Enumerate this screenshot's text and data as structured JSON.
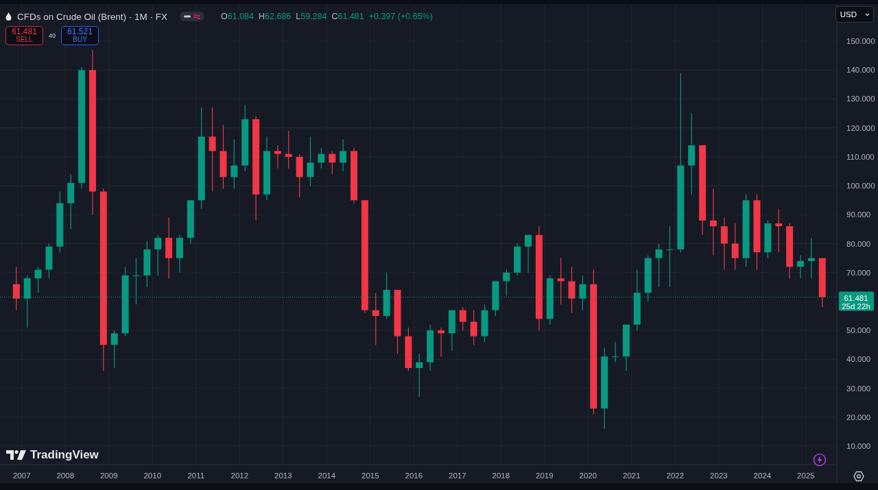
{
  "legend": {
    "symbol": "CFDs on Crude Oil (Brent) · 1M · FX",
    "visible": true,
    "ohlc": [
      {
        "letter": "O",
        "value": "61.084"
      },
      {
        "letter": "H",
        "value": "62.686"
      },
      {
        "letter": "L",
        "value": "59.284"
      },
      {
        "letter": "C",
        "value": "61.481"
      }
    ],
    "change": "+0.397 (+0.65%)"
  },
  "trade": {
    "sell": {
      "price": "61.481",
      "label": "SELL"
    },
    "spread": "40",
    "buy": {
      "price": "61.521",
      "label": "BUY"
    }
  },
  "currency": "USD",
  "price_tag": {
    "price": "61.481",
    "countdown": "25d 22h"
  },
  "brand": "TradingView",
  "chart_data": {
    "type": "candlestick",
    "grid": true,
    "x": [
      2006.875,
      2007.125,
      2007.375,
      2007.625,
      2007.875,
      2008.125,
      2008.375,
      2008.625,
      2008.875,
      2009.125,
      2009.375,
      2009.625,
      2009.875,
      2010.125,
      2010.375,
      2010.625,
      2010.875,
      2011.125,
      2011.375,
      2011.625,
      2011.875,
      2012.125,
      2012.375,
      2012.625,
      2012.875,
      2013.125,
      2013.375,
      2013.625,
      2013.875,
      2014.125,
      2014.375,
      2014.625,
      2014.875,
      2015.125,
      2015.375,
      2015.625,
      2015.875,
      2016.125,
      2016.375,
      2016.625,
      2016.875,
      2017.125,
      2017.375,
      2017.625,
      2017.875,
      2018.125,
      2018.375,
      2018.625,
      2018.875,
      2019.125,
      2019.375,
      2019.625,
      2019.875,
      2020.125,
      2020.375,
      2020.625,
      2020.875,
      2021.125,
      2021.375,
      2021.625,
      2021.875,
      2022.125,
      2022.375,
      2022.625,
      2022.875,
      2023.125,
      2023.375,
      2023.625,
      2023.875,
      2024.125,
      2024.375,
      2024.625,
      2024.875,
      2025.125,
      2025.375
    ],
    "ohlc": [
      [
        66,
        72,
        57,
        61
      ],
      [
        61,
        69,
        51,
        68
      ],
      [
        68,
        72,
        63,
        71
      ],
      [
        71,
        80,
        68,
        79
      ],
      [
        79,
        98,
        77,
        94
      ],
      [
        94,
        104,
        85,
        101
      ],
      [
        101,
        141,
        99,
        140
      ],
      [
        140,
        147,
        90,
        98
      ],
      [
        98,
        99,
        36,
        45
      ],
      [
        45,
        50,
        37,
        49
      ],
      [
        49,
        72,
        48,
        69
      ],
      [
        69,
        75,
        59,
        69
      ],
      [
        69,
        81,
        65,
        78
      ],
      [
        78,
        83,
        69,
        82
      ],
      [
        82,
        89,
        68,
        75
      ],
      [
        75,
        83,
        70,
        82
      ],
      [
        82,
        95,
        80,
        95
      ],
      [
        95,
        127,
        92,
        117
      ],
      [
        117,
        127,
        98,
        112
      ],
      [
        112,
        121,
        99,
        103
      ],
      [
        103,
        116,
        99,
        107
      ],
      [
        107,
        128,
        105,
        123
      ],
      [
        123,
        124,
        88,
        97
      ],
      [
        97,
        117,
        95,
        112
      ],
      [
        112,
        114,
        106,
        111
      ],
      [
        111,
        119,
        106,
        110
      ],
      [
        110,
        111,
        96,
        103
      ],
      [
        103,
        117,
        100,
        108
      ],
      [
        108,
        113,
        106,
        111
      ],
      [
        111,
        112,
        104,
        108
      ],
      [
        108,
        116,
        105,
        112
      ],
      [
        112,
        113,
        94,
        95
      ],
      [
        95,
        95,
        56,
        57
      ],
      [
        57,
        63,
        45,
        55
      ],
      [
        55,
        70,
        54,
        64
      ],
      [
        64,
        64,
        42,
        48
      ],
      [
        48,
        51,
        36,
        37
      ],
      [
        37,
        42,
        27,
        39
      ],
      [
        39,
        52,
        36,
        50
      ],
      [
        50,
        51,
        41,
        49
      ],
      [
        49,
        57,
        43,
        57
      ],
      [
        57,
        58,
        50,
        53
      ],
      [
        53,
        57,
        45,
        48
      ],
      [
        48,
        59,
        46,
        57
      ],
      [
        57,
        67,
        55,
        67
      ],
      [
        67,
        71,
        62,
        70
      ],
      [
        70,
        80,
        69,
        79
      ],
      [
        79,
        83,
        70,
        83
      ],
      [
        83,
        86,
        50,
        54
      ],
      [
        54,
        69,
        52,
        68
      ],
      [
        68,
        75,
        59,
        67
      ],
      [
        67,
        72,
        56,
        61
      ],
      [
        61,
        69,
        57,
        66
      ],
      [
        66,
        71,
        21,
        23
      ],
      [
        23,
        44,
        16,
        41
      ],
      [
        41,
        46,
        39,
        41
      ],
      [
        41,
        52,
        36,
        52
      ],
      [
        52,
        71,
        50,
        63
      ],
      [
        63,
        76,
        60,
        75
      ],
      [
        75,
        80,
        65,
        78
      ],
      [
        78,
        86,
        65,
        78
      ],
      [
        78,
        139,
        77,
        107
      ],
      [
        107,
        125,
        97,
        114
      ],
      [
        114,
        114,
        83,
        88
      ],
      [
        88,
        99,
        76,
        86
      ],
      [
        86,
        89,
        71,
        80
      ],
      [
        80,
        87,
        71,
        75
      ],
      [
        75,
        97,
        72,
        95
      ],
      [
        95,
        97,
        71,
        77
      ],
      [
        77,
        88,
        75,
        87
      ],
      [
        87,
        92,
        77,
        86
      ],
      [
        86,
        87,
        68,
        72
      ],
      [
        72,
        76,
        68,
        74
      ],
      [
        74,
        82,
        68,
        75
      ],
      [
        75,
        75,
        58,
        61.5
      ]
    ],
    "ref_lines": [
      {
        "axis": "y",
        "value": 61.5
      }
    ],
    "xlim": [
      2006.5,
      2025.71
    ],
    "ylim": [
      3.6,
      162.8
    ],
    "yticks": [
      {
        "value": 10,
        "label": "10.000"
      },
      {
        "value": 20,
        "label": "20.000"
      },
      {
        "value": 30,
        "label": "30.000"
      },
      {
        "value": 40,
        "label": "40.000"
      },
      {
        "value": 50,
        "label": "50.000"
      },
      {
        "value": 70,
        "label": "70.000"
      },
      {
        "value": 80,
        "label": "80.000"
      },
      {
        "value": 90,
        "label": "90.000"
      },
      {
        "value": 100,
        "label": "100.000"
      },
      {
        "value": 110,
        "label": "110.000"
      },
      {
        "value": 120,
        "label": "120.000"
      },
      {
        "value": 130,
        "label": "130.000"
      },
      {
        "value": 140,
        "label": "140.000"
      },
      {
        "value": 150,
        "label": "150.000"
      }
    ],
    "xticks": [
      2007,
      2008,
      2009,
      2010,
      2011,
      2012,
      2013,
      2014,
      2015,
      2016,
      2017,
      2018,
      2019,
      2020,
      2021,
      2022,
      2023,
      2024,
      2025
    ]
  }
}
